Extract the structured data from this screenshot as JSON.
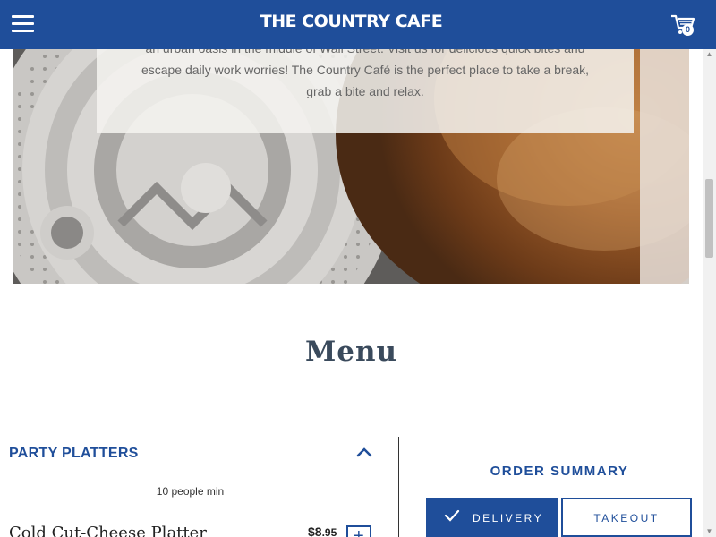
{
  "header": {
    "brand": "THE COUNTRY CAFE",
    "menu_icon": "hamburger-icon",
    "cart_icon": "shopping-cart-icon",
    "cart_count": "0",
    "bg_color": "#1f4e9a"
  },
  "hero": {
    "about_text": "an urban oasis in the middle of Wall Street. Visit us for delicious quick bites and escape daily work worries! The Country Café is the perfect place to take a break, grab a bite and relax."
  },
  "menu": {
    "title": "Menu",
    "category": {
      "name": "PARTY PLATTERS",
      "chevron_icon": "chevron-up-icon",
      "note": "10 people min",
      "items": [
        {
          "name": "Cold Cut-Cheese Platter",
          "price_dollars": "$8",
          "price_cents": ".95",
          "add_icon": "plus-icon"
        }
      ]
    }
  },
  "order_summary": {
    "title": "ORDER SUMMARY",
    "delivery_label": "DELIVERY",
    "takeout_label": "TAKEOUT",
    "selected": "delivery",
    "check_icon": "check-icon"
  },
  "colors": {
    "accent": "#1f4e9a",
    "text": "#222222"
  }
}
